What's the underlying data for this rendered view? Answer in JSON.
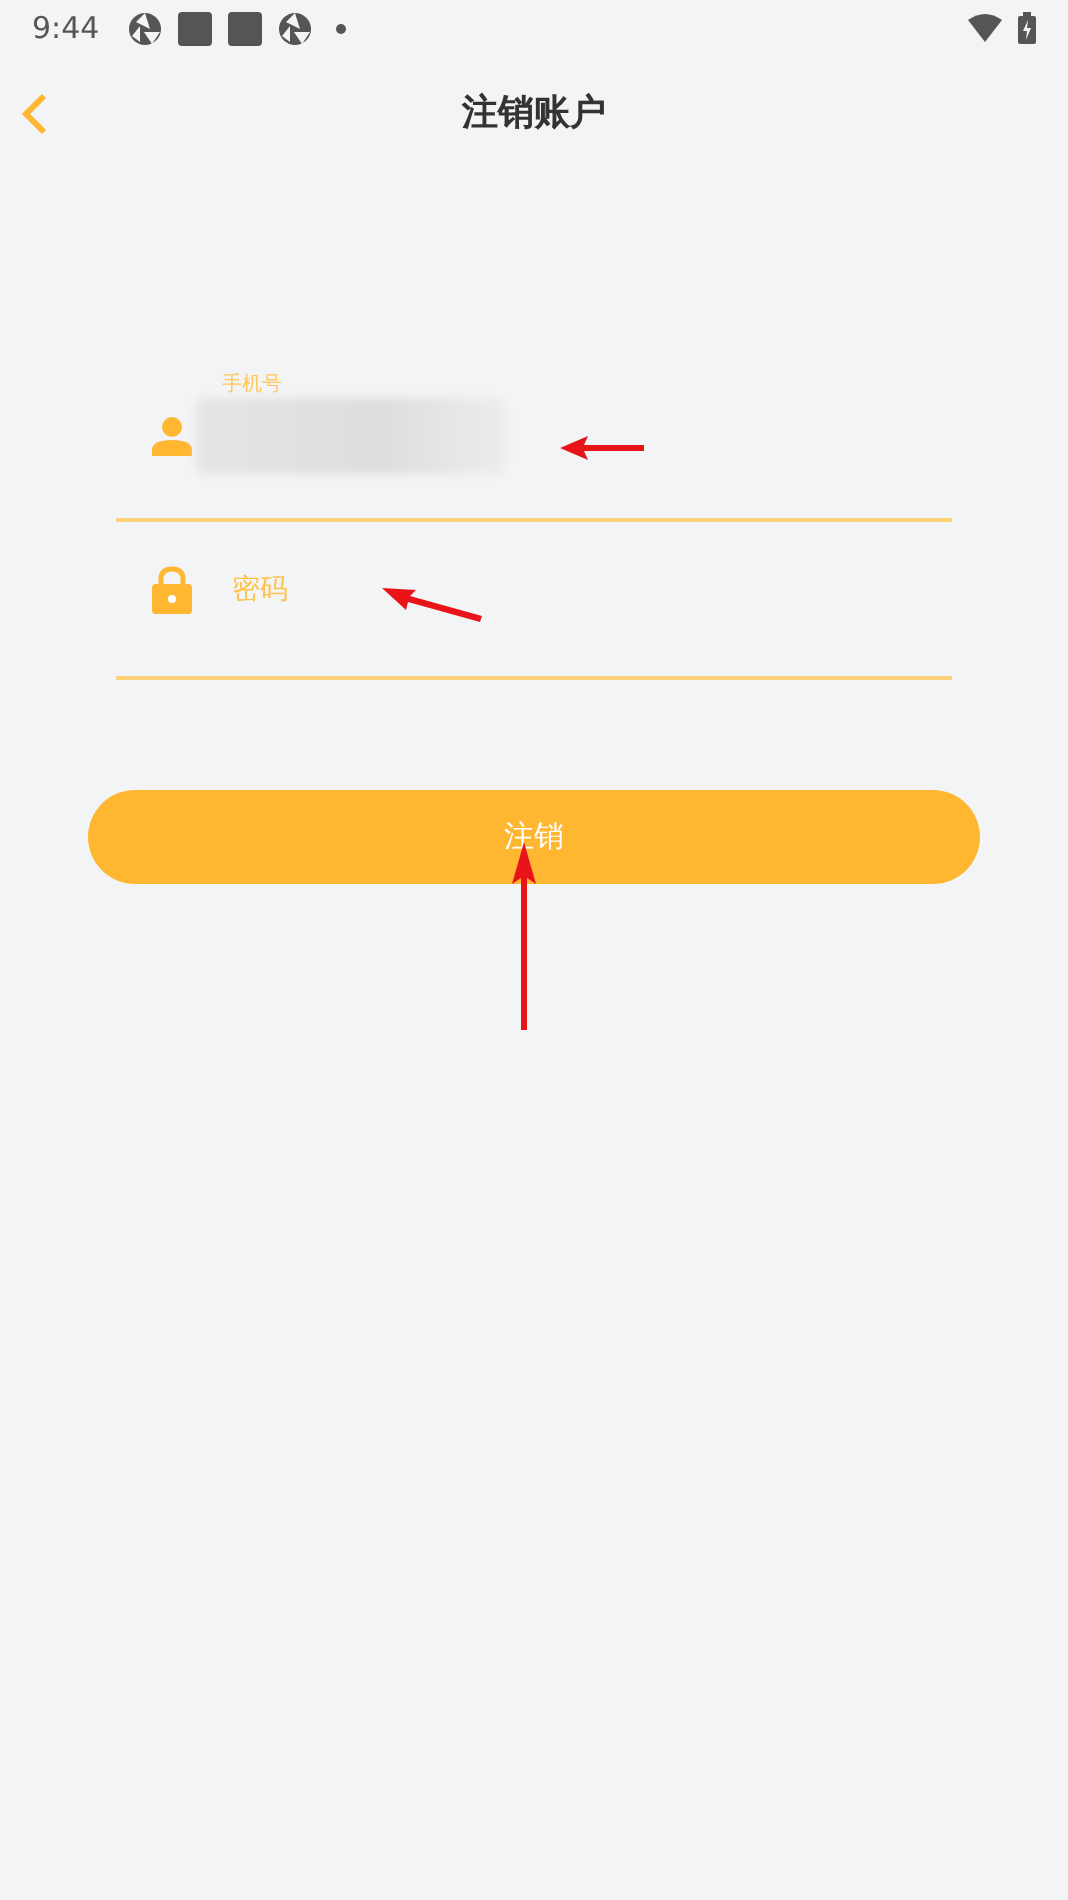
{
  "status_bar": {
    "time": "9:44"
  },
  "header": {
    "title": "注销账户"
  },
  "fields": [
    {
      "kind": "phone",
      "label": "手机号",
      "value_hidden": true
    },
    {
      "kind": "password",
      "placeholder": "密码"
    }
  ],
  "submit_button": {
    "label": "注销"
  },
  "annotations": [
    {
      "kind": "arrow"
    },
    {
      "kind": "arrow"
    },
    {
      "kind": "arrow"
    }
  ]
}
